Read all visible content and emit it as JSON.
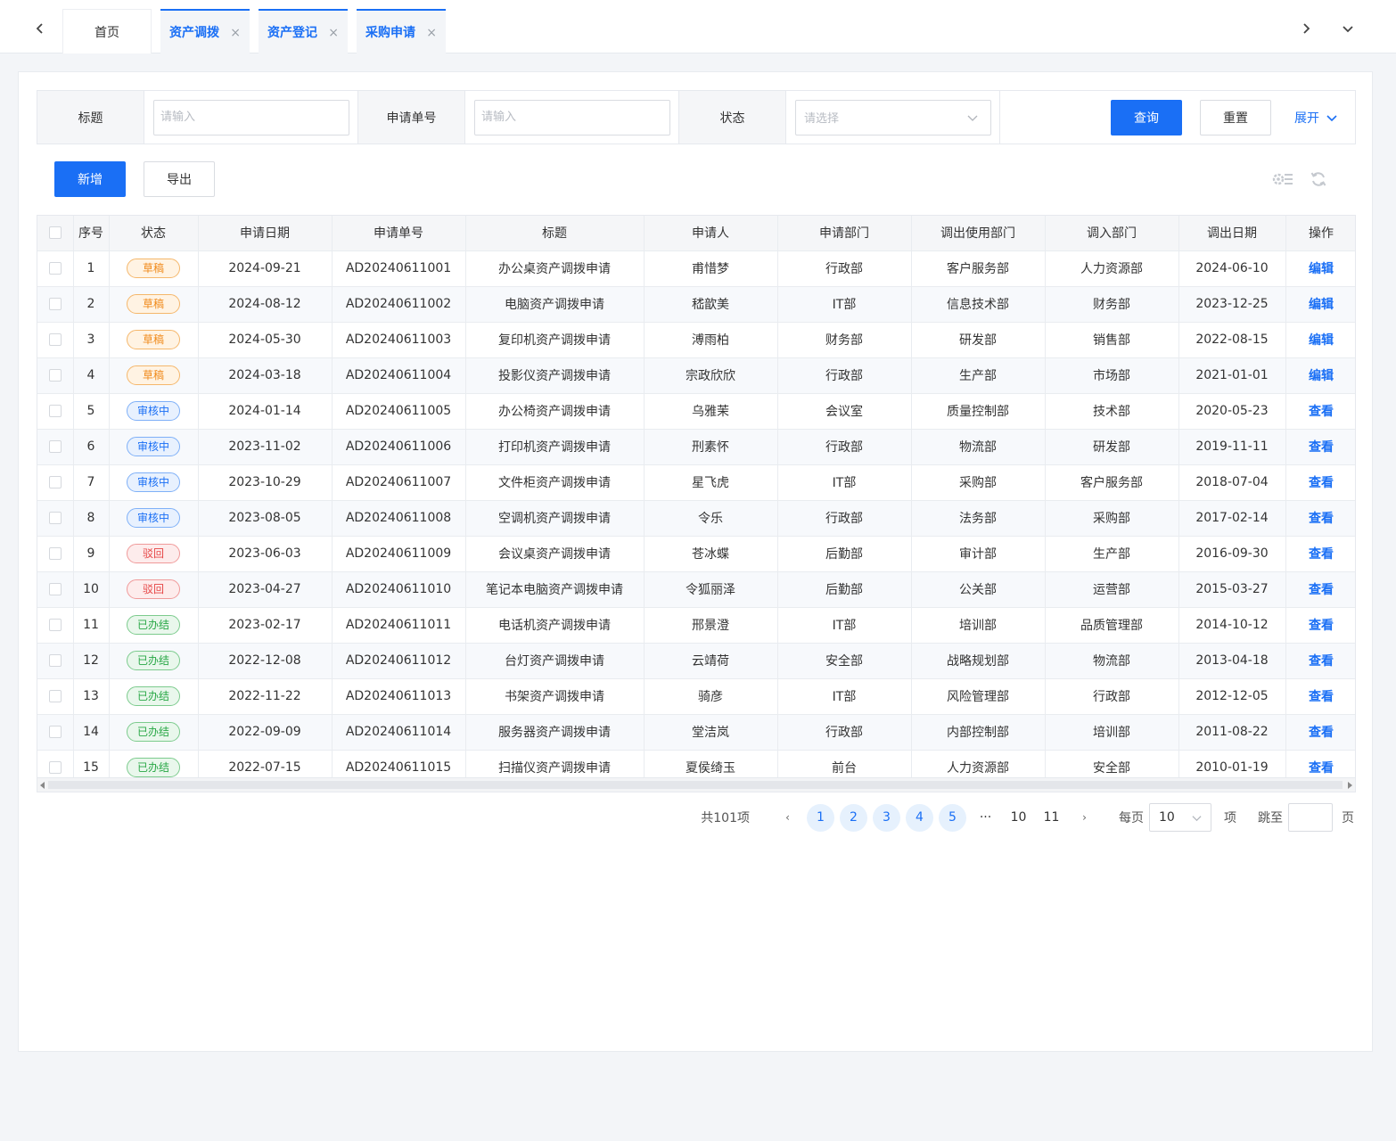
{
  "tabs": {
    "home": "首页",
    "open": [
      {
        "label": "资产调拨"
      },
      {
        "label": "资产登记"
      },
      {
        "label": "采购申请"
      }
    ],
    "close_glyph": "×"
  },
  "filter": {
    "title_label": "标题",
    "title_placeholder": "请输入",
    "order_label": "申请单号",
    "order_placeholder": "请输入",
    "status_label": "状态",
    "status_placeholder": "请选择",
    "query_label": "查询",
    "reset_label": "重置",
    "expand_label": "展开"
  },
  "toolbar": {
    "add_label": "新增",
    "export_label": "导出",
    "icons": [
      "column-settings-icon",
      "refresh-icon"
    ]
  },
  "table": {
    "headers": [
      "序号",
      "状态",
      "申请日期",
      "申请单号",
      "标题",
      "申请人",
      "申请部门",
      "调出使用部门",
      "调入部门",
      "调出日期",
      "操作"
    ],
    "status_styles": {
      "草稿": {
        "color": "#f08a1a",
        "bg": "#fff3e3",
        "border": "#f5b76b"
      },
      "审核中": {
        "color": "#1a6ff5",
        "bg": "#e8f1fe",
        "border": "#7fb0f7"
      },
      "驳回": {
        "color": "#e64545",
        "bg": "#fdecec",
        "border": "#f09a9a"
      },
      "已办结": {
        "color": "#28a745",
        "bg": "#e9f7ec",
        "border": "#7ccb8d"
      }
    },
    "rows": [
      {
        "no": "1",
        "status": "草稿",
        "date": "2024-09-21",
        "order": "AD20240611001",
        "title": "办公桌资产调拨申请",
        "applicant": "甫惜梦",
        "dept": "行政部",
        "out_dept": "客户服务部",
        "in_dept": "人力资源部",
        "out_date": "2024-06-10",
        "action": "编辑"
      },
      {
        "no": "2",
        "status": "草稿",
        "date": "2024-08-12",
        "order": "AD20240611002",
        "title": "电脑资产调拨申请",
        "applicant": "嵇歆美",
        "dept": "IT部",
        "out_dept": "信息技术部",
        "in_dept": "财务部",
        "out_date": "2023-12-25",
        "action": "编辑"
      },
      {
        "no": "3",
        "status": "草稿",
        "date": "2024-05-30",
        "order": "AD20240611003",
        "title": "复印机资产调拨申请",
        "applicant": "溥雨柏",
        "dept": "财务部",
        "out_dept": "研发部",
        "in_dept": "销售部",
        "out_date": "2022-08-15",
        "action": "编辑"
      },
      {
        "no": "4",
        "status": "草稿",
        "date": "2024-03-18",
        "order": "AD20240611004",
        "title": "投影仪资产调拨申请",
        "applicant": "宗政欣欣",
        "dept": "行政部",
        "out_dept": "生产部",
        "in_dept": "市场部",
        "out_date": "2021-01-01",
        "action": "编辑"
      },
      {
        "no": "5",
        "status": "审核中",
        "date": "2024-01-14",
        "order": "AD20240611005",
        "title": "办公椅资产调拨申请",
        "applicant": "乌雅茉",
        "dept": "会议室",
        "out_dept": "质量控制部",
        "in_dept": "技术部",
        "out_date": "2020-05-23",
        "action": "查看"
      },
      {
        "no": "6",
        "status": "审核中",
        "date": "2023-11-02",
        "order": "AD20240611006",
        "title": "打印机资产调拨申请",
        "applicant": "刑素怀",
        "dept": "行政部",
        "out_dept": "物流部",
        "in_dept": "研发部",
        "out_date": "2019-11-11",
        "action": "查看"
      },
      {
        "no": "7",
        "status": "审核中",
        "date": "2023-10-29",
        "order": "AD20240611007",
        "title": "文件柜资产调拨申请",
        "applicant": "星飞虎",
        "dept": "IT部",
        "out_dept": "采购部",
        "in_dept": "客户服务部",
        "out_date": "2018-07-04",
        "action": "查看"
      },
      {
        "no": "8",
        "status": "审核中",
        "date": "2023-08-05",
        "order": "AD20240611008",
        "title": "空调机资产调拨申请",
        "applicant": "令乐",
        "dept": "行政部",
        "out_dept": "法务部",
        "in_dept": "采购部",
        "out_date": "2017-02-14",
        "action": "查看"
      },
      {
        "no": "9",
        "status": "驳回",
        "date": "2023-06-03",
        "order": "AD20240611009",
        "title": "会议桌资产调拨申请",
        "applicant": "苍冰蝶",
        "dept": "后勤部",
        "out_dept": "审计部",
        "in_dept": "生产部",
        "out_date": "2016-09-30",
        "action": "查看"
      },
      {
        "no": "10",
        "status": "驳回",
        "date": "2023-04-27",
        "order": "AD20240611010",
        "title": "笔记本电脑资产调拨申请",
        "applicant": "令狐丽泽",
        "dept": "后勤部",
        "out_dept": "公关部",
        "in_dept": "运营部",
        "out_date": "2015-03-27",
        "action": "查看"
      },
      {
        "no": "11",
        "status": "已办结",
        "date": "2023-02-17",
        "order": "AD20240611011",
        "title": "电话机资产调拨申请",
        "applicant": "邢景澄",
        "dept": "IT部",
        "out_dept": "培训部",
        "in_dept": "品质管理部",
        "out_date": "2014-10-12",
        "action": "查看"
      },
      {
        "no": "12",
        "status": "已办结",
        "date": "2022-12-08",
        "order": "AD20240611012",
        "title": "台灯资产调拨申请",
        "applicant": "云靖荷",
        "dept": "安全部",
        "out_dept": "战略规划部",
        "in_dept": "物流部",
        "out_date": "2013-04-18",
        "action": "查看"
      },
      {
        "no": "13",
        "status": "已办结",
        "date": "2022-11-22",
        "order": "AD20240611013",
        "title": "书架资产调拨申请",
        "applicant": "骑彦",
        "dept": "IT部",
        "out_dept": "风险管理部",
        "in_dept": "行政部",
        "out_date": "2012-12-05",
        "action": "查看"
      },
      {
        "no": "14",
        "status": "已办结",
        "date": "2022-09-09",
        "order": "AD20240611014",
        "title": "服务器资产调拨申请",
        "applicant": "堂洁岚",
        "dept": "行政部",
        "out_dept": "内部控制部",
        "in_dept": "培训部",
        "out_date": "2011-08-22",
        "action": "查看"
      },
      {
        "no": "15",
        "status": "已办结",
        "date": "2022-07-15",
        "order": "AD20240611015",
        "title": "扫描仪资产调拨申请",
        "applicant": "夏侯绮玉",
        "dept": "前台",
        "out_dept": "人力资源部",
        "in_dept": "安全部",
        "out_date": "2010-01-19",
        "action": "查看"
      }
    ]
  },
  "pagination": {
    "total": "共101项",
    "prev": "‹",
    "next": "›",
    "pages": [
      {
        "label": "1",
        "highlight": true
      },
      {
        "label": "2",
        "highlight": true
      },
      {
        "label": "3",
        "highlight": true
      },
      {
        "label": "4",
        "highlight": true
      },
      {
        "label": "5",
        "highlight": true
      },
      {
        "label": "···",
        "highlight": false
      },
      {
        "label": "10",
        "highlight": false
      },
      {
        "label": "11",
        "highlight": false
      }
    ],
    "size_label": "每页",
    "size_value": "10",
    "size_unit": "项",
    "jump_label": "跳至",
    "jump_unit": "页"
  },
  "colors": {
    "accent": "#1a6ff5"
  }
}
